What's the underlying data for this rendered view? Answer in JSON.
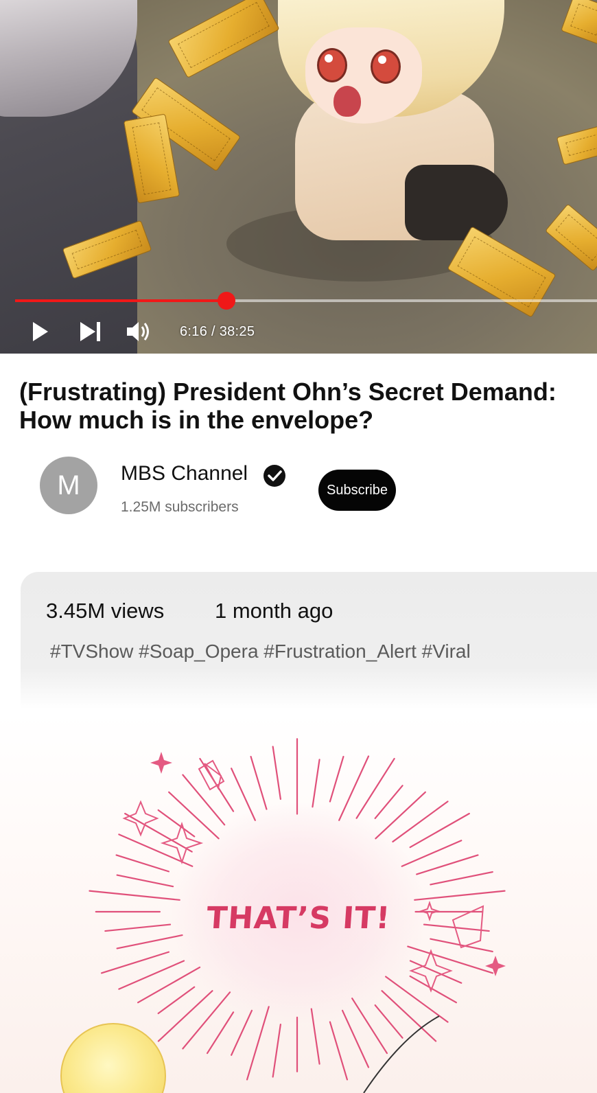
{
  "player": {
    "current_time": "6:16",
    "duration": "38:25",
    "time_display": "6:16 / 38:25",
    "progress_fraction": 0.3627,
    "accent_color": "#f01818",
    "controls": [
      "play-icon",
      "next-icon",
      "volume-icon"
    ]
  },
  "video": {
    "title": "(Frustrating) President Ohn’s Secret Demand: How much is in the envelope?"
  },
  "channel": {
    "avatar_letter": "M",
    "name": "MBS Channel",
    "subscribers": "1.25M subscribers",
    "subscribe_label": "Subscribe"
  },
  "description": {
    "views": "3.45M views",
    "uploaded": "1 month ago",
    "tags": "#TVShow #Soap_Opera #Frustration_Alert #Viral"
  },
  "comic": {
    "exclamation": "THAT’S IT!",
    "exclamation_color": "#d63a63"
  }
}
